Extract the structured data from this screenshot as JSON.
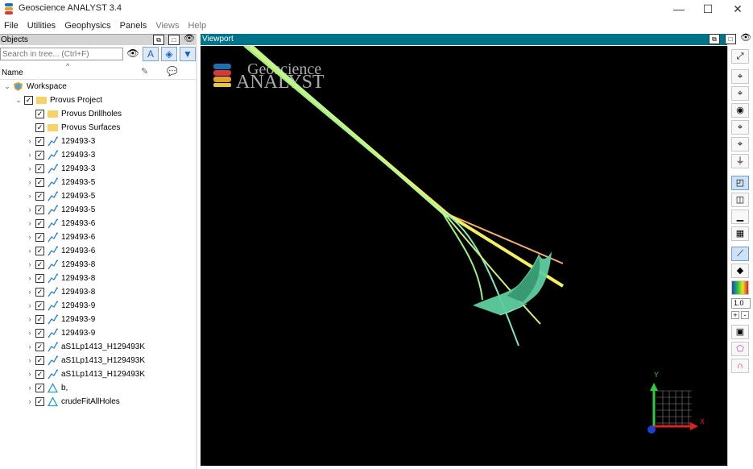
{
  "window": {
    "title": "Geoscience ANALYST 3.4",
    "controls": {
      "minimize": "—",
      "maximize": "☐",
      "close": "✕"
    }
  },
  "menu": [
    "File",
    "Utilities",
    "Geophysics",
    "Panels",
    "Views",
    "Help"
  ],
  "objects_panel": {
    "title": "Objects",
    "search_placeholder": "Search in tree... (Ctrl+F)",
    "column_name": "Name",
    "tree": [
      {
        "label": "Workspace",
        "level": 0,
        "icon": "workspace-icon",
        "expanded": true,
        "checkbox": false
      },
      {
        "label": "Provus Project",
        "level": 1,
        "icon": "folder-icon",
        "expanded": true,
        "checkbox": true
      },
      {
        "label": "Provus Drillholes",
        "level": 2,
        "icon": "folder-icon",
        "expander": false,
        "checkbox": true
      },
      {
        "label": "Provus Surfaces",
        "level": 2,
        "icon": "folder-icon",
        "expander": false,
        "checkbox": true
      },
      {
        "label": "129493-3",
        "level": 2,
        "icon": "drillhole-icon",
        "checkbox": true
      },
      {
        "label": "129493-3",
        "level": 2,
        "icon": "drillhole-icon",
        "checkbox": true
      },
      {
        "label": "129493-3",
        "level": 2,
        "icon": "drillhole-icon",
        "checkbox": true
      },
      {
        "label": "129493-5",
        "level": 2,
        "icon": "drillhole-icon",
        "checkbox": true
      },
      {
        "label": "129493-5",
        "level": 2,
        "icon": "drillhole-icon",
        "checkbox": true
      },
      {
        "label": "129493-5",
        "level": 2,
        "icon": "drillhole-icon",
        "checkbox": true
      },
      {
        "label": "129493-6",
        "level": 2,
        "icon": "drillhole-icon",
        "checkbox": true
      },
      {
        "label": "129493-6",
        "level": 2,
        "icon": "drillhole-icon",
        "checkbox": true
      },
      {
        "label": "129493-6",
        "level": 2,
        "icon": "drillhole-icon",
        "checkbox": true
      },
      {
        "label": "129493-8",
        "level": 2,
        "icon": "drillhole-icon",
        "checkbox": true
      },
      {
        "label": "129493-8",
        "level": 2,
        "icon": "drillhole-icon",
        "checkbox": true
      },
      {
        "label": "129493-8",
        "level": 2,
        "icon": "drillhole-icon",
        "checkbox": true
      },
      {
        "label": "129493-9",
        "level": 2,
        "icon": "drillhole-icon",
        "checkbox": true
      },
      {
        "label": "129493-9",
        "level": 2,
        "icon": "drillhole-icon",
        "checkbox": true
      },
      {
        "label": "129493-9",
        "level": 2,
        "icon": "drillhole-icon",
        "checkbox": true
      },
      {
        "label": "aS1Lp1413_H129493K",
        "level": 2,
        "icon": "drillhole-icon",
        "checkbox": true
      },
      {
        "label": "aS1Lp1413_H129493K",
        "level": 2,
        "icon": "drillhole-icon",
        "checkbox": true
      },
      {
        "label": "aS1Lp1413_H129493K",
        "level": 2,
        "icon": "drillhole-icon",
        "checkbox": true
      },
      {
        "label": "b,",
        "level": 2,
        "icon": "surface-icon",
        "checkbox": true
      },
      {
        "label": "crudeFitAllHoles",
        "level": 2,
        "icon": "surface-icon",
        "checkbox": true
      }
    ]
  },
  "viewport": {
    "title": "Viewport",
    "logo_line1": "Geoscience",
    "logo_line2": "ANALYST",
    "axis_x": "X",
    "axis_y": "Y"
  },
  "right_toolbar": {
    "zoom_value": "1.0",
    "plus": "+",
    "minus": "-"
  },
  "colors": {
    "viewport_header": "#00738a",
    "surface": "#5fcfa0"
  }
}
